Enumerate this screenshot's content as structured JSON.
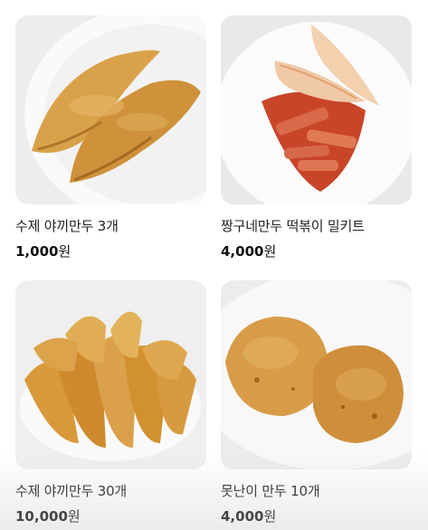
{
  "products": [
    {
      "name": "수제 야끼만두 3개",
      "price": "1,000",
      "unit": "원",
      "image": "fried-dumplings-3-photo"
    },
    {
      "name": "짱구네만두 떡볶이 밀키트",
      "price": "4,000",
      "unit": "원",
      "image": "tteokbokki-meal-kit-photo"
    },
    {
      "name": "수제 야끼만두 30개",
      "price": "10,000",
      "unit": "원",
      "image": "fried-dumplings-30-photo"
    },
    {
      "name": "못난이 만두 10개",
      "price": "4,000",
      "unit": "원",
      "image": "ugly-dumplings-photo"
    }
  ]
}
